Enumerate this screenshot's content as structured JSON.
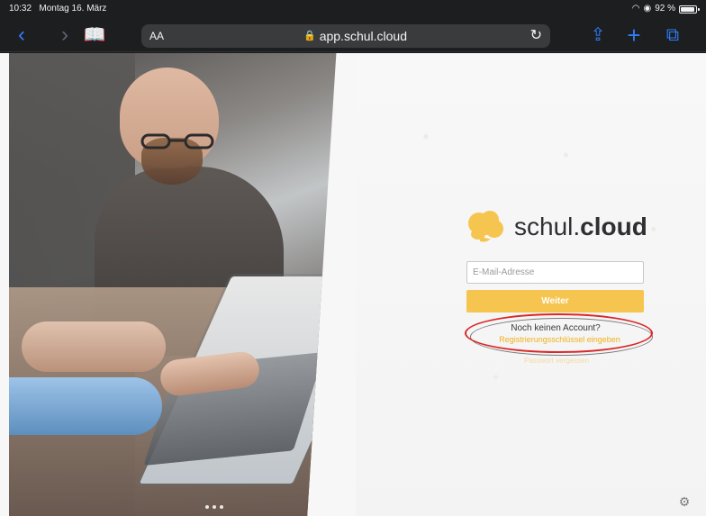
{
  "status_bar": {
    "time": "10:32",
    "date": "Montag 16. März",
    "battery": "92 %",
    "wifi_icon": "wifi-icon",
    "signal_icon": "signal-icon",
    "battery_icon": "battery-icon"
  },
  "browser": {
    "text_size": "AA",
    "url": "app.schul.cloud",
    "back_icon": "chevron-left-icon",
    "forward_icon": "chevron-right-icon",
    "bookmarks_icon": "book-icon",
    "reload_icon": "reload-icon",
    "share_icon": "share-icon",
    "add_icon": "plus-icon",
    "tabs_icon": "tabs-icon",
    "lock_icon": "lock-icon"
  },
  "login": {
    "brand_regular": "schul.",
    "brand_bold": "cloud",
    "email_placeholder": "E-Mail-Adresse",
    "next_button": "Weiter",
    "no_account": "Noch keinen Account?",
    "register_link": "Registrierungsschlüssel eingeben",
    "secondary_link": "Passwort vergessen"
  },
  "colors": {
    "accent": "#F6C54F",
    "link": "#F2B11B",
    "annotation_red": "#D92828",
    "browser_blue": "#2F7DF6"
  },
  "icons": {
    "settings_icon": "gear-icon"
  }
}
